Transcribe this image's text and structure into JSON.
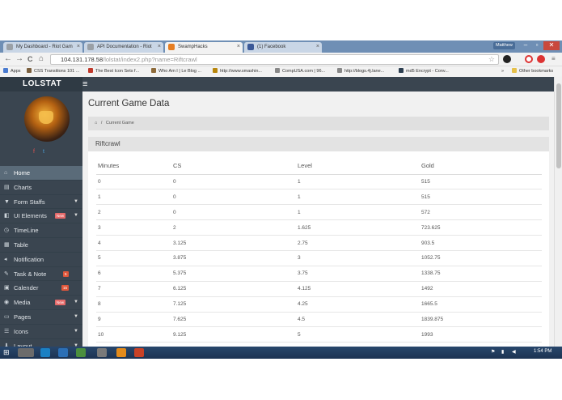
{
  "browser": {
    "tabs": [
      {
        "label": "My Dashboard - Riot Gam",
        "favicon_color": "#9aa0a6"
      },
      {
        "label": "API Documentation - Riot",
        "favicon_color": "#9aa0a6"
      },
      {
        "label": "SwampHacks",
        "favicon_color": "#e67e22"
      },
      {
        "label": "(1) Facebook",
        "favicon_color": "#3b5998"
      }
    ],
    "tab_close": "×",
    "user_chip": "Matthew",
    "win_min": "–",
    "win_max": "▫",
    "win_close": "✕",
    "nav_back": "←",
    "nav_forward": "→",
    "nav_reload": "C",
    "nav_home": "⌂",
    "url_host": "104.131.178.58",
    "url_path": "/lolstat/index2.php?name=Riftcrawl",
    "star": "☆"
  },
  "bookmarks": {
    "apps": "Apps",
    "items": [
      {
        "label": "CSS Transitions 101 ...",
        "color": "#7a5f3e"
      },
      {
        "label": "The Best Icon Sets f...",
        "color": "#c0392b"
      },
      {
        "label": "Who Am I | Le Blog ...",
        "color": "#8e6b3a"
      },
      {
        "label": "http://www.smashin...",
        "color": "#b8860b"
      },
      {
        "label": "CompUSA.com | 96...",
        "color": "#888888"
      },
      {
        "label": "http://blogs.4j.lane...",
        "color": "#888888"
      },
      {
        "label": "md5 Encrypt - Conv...",
        "color": "#2c3e50"
      }
    ],
    "other": "Other bookmarks",
    "more": "»"
  },
  "sidebar": {
    "brand": "LOLSTAT",
    "facebook_icon": "f",
    "twitter_icon": "t",
    "items": [
      {
        "label": "Home",
        "icon": "⌂",
        "caret": "",
        "badge": "",
        "active": true
      },
      {
        "label": "Charts",
        "icon": "▤",
        "caret": "",
        "badge": ""
      },
      {
        "label": "Form Staffs",
        "icon": "▼",
        "caret": "▼",
        "badge": ""
      },
      {
        "label": "UI Elements",
        "icon": "◧",
        "caret": "▼",
        "badge": "New"
      },
      {
        "label": "TimeLine",
        "icon": "◷",
        "caret": "",
        "badge": ""
      },
      {
        "label": "Table",
        "icon": "▦",
        "caret": "",
        "badge": ""
      },
      {
        "label": "Notification",
        "icon": "◂",
        "caret": "",
        "badge": ""
      },
      {
        "label": "Task & Note",
        "icon": "✎",
        "caret": "",
        "badge": "5"
      },
      {
        "label": "Calender",
        "icon": "▣",
        "caret": "",
        "badge": "15"
      },
      {
        "label": "Media",
        "icon": "◉",
        "caret": "▼",
        "badge": "New"
      },
      {
        "label": "Pages",
        "icon": "▭",
        "caret": "▼",
        "badge": ""
      },
      {
        "label": "Icons",
        "icon": "☰",
        "caret": "▼",
        "badge": ""
      },
      {
        "label": "Layout",
        "icon": "⬇",
        "caret": "▼",
        "badge": ""
      }
    ]
  },
  "main": {
    "hamburger": "≡",
    "title": "Current Game Data",
    "breadcrumb_home_icon": "⌂",
    "breadcrumb_sep": "/",
    "breadcrumb": "Current Game",
    "panel_title": "Riftcrawl",
    "columns": [
      "Minutes",
      "CS",
      "Level",
      "Gold"
    ],
    "rows": [
      [
        "0",
        "0",
        "1",
        "515"
      ],
      [
        "1",
        "0",
        "1",
        "515"
      ],
      [
        "2",
        "0",
        "1",
        "572"
      ],
      [
        "3",
        "2",
        "1.625",
        "723.625"
      ],
      [
        "4",
        "3.125",
        "2.75",
        "903.5"
      ],
      [
        "5",
        "3.875",
        "3",
        "1052.75"
      ],
      [
        "6",
        "5.375",
        "3.75",
        "1338.75"
      ],
      [
        "7",
        "6.125",
        "4.125",
        "1492"
      ],
      [
        "8",
        "7.125",
        "4.25",
        "1665.5"
      ],
      [
        "9",
        "7.625",
        "4.5",
        "1839.875"
      ],
      [
        "10",
        "9.125",
        "5",
        "1993"
      ]
    ]
  },
  "taskbar": {
    "start": "⊞",
    "clock": "1:54 PM"
  }
}
